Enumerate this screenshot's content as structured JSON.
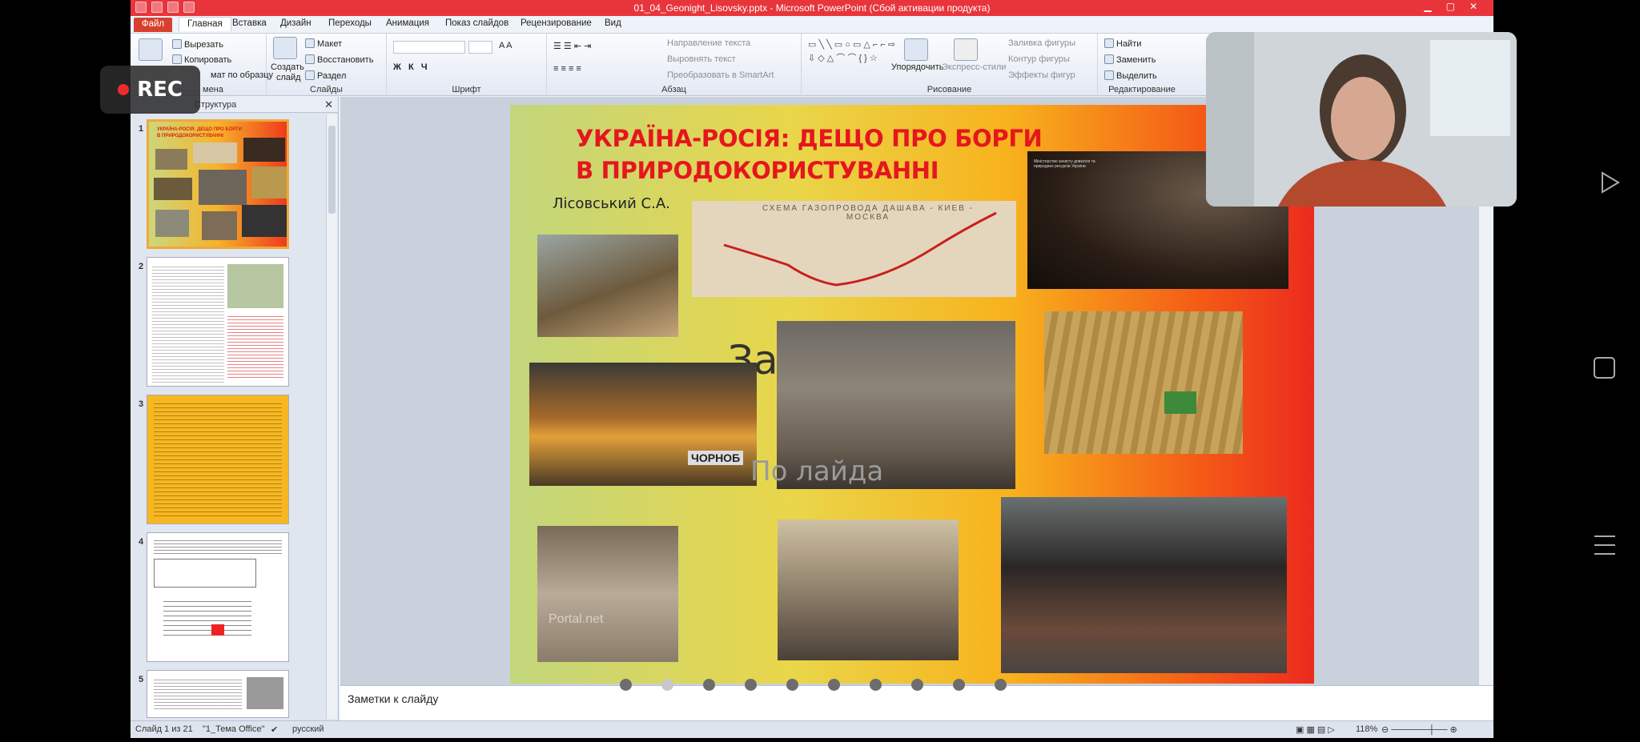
{
  "titlebar": {
    "title": "01_04_Geonight_Lisovsky.pptx - Microsoft PowerPoint (Сбой активации продукта)"
  },
  "tabs": [
    "Файл",
    "Главная",
    "Вставка",
    "Дизайн",
    "Переходы",
    "Анимация",
    "Показ слайдов",
    "Рецензирование",
    "Вид"
  ],
  "ribbon": {
    "clipboard": {
      "cut": "Вырезать",
      "copy": "Копировать",
      "format_painter": "мат по образцу",
      "label": "мена"
    },
    "slides": {
      "create": "Создать",
      "slide": "слайд",
      "layout": "Макет",
      "restore": "Восстановить",
      "section": "Раздел",
      "label": "Слайды"
    },
    "font": {
      "label": "Шрифт"
    },
    "paragraph": {
      "text_direction": "Направление текста",
      "align_text": "Выровнять текст",
      "smartart": "Преобразовать в SmartArt",
      "label": "Абзац"
    },
    "drawing": {
      "arrange": "Упорядочить",
      "quick_styles": "Экспресс-стили",
      "fill": "Заливка фигуры",
      "outline": "Контур фигуры",
      "effects": "Эффекты фигур",
      "label": "Рисование"
    },
    "editing": {
      "find": "Найти",
      "replace": "Заменить",
      "select": "Выделить",
      "label": "Редактирование"
    }
  },
  "rec_label": "REC",
  "panel": {
    "structure_tab": "Структура",
    "close": "✕"
  },
  "thumbnails": [
    {
      "num": "1",
      "title": "УКРАЇНА-РОСІЯ: ДЕЩО ПРО БОРГИ В ПРИРОДОКОРИСТУВАННІ"
    },
    {
      "num": "2"
    },
    {
      "num": "3"
    },
    {
      "num": "4"
    },
    {
      "num": "5"
    }
  ],
  "slide": {
    "title": "УКРАЇНА-РОСІЯ: ДЕЩО  ПРО БОРГИ В ПРИРОДОКОРИСТУВАННІ",
    "author": "Лісовський С.А.",
    "map_caption": "СХЕМА ГАЗОПРОВОДА ДАШАВА - КИЕВ - МОСКВА",
    "placeholder_title": "За           лай",
    "placeholder_subtitle": "По                  лайда",
    "watermark": "Portal.net",
    "ministry_text": "Міністерство захисту довкілля та природних ресурсів України",
    "sign_text": "ЧОРНОБ"
  },
  "notes": {
    "placeholder": "Заметки к слайду"
  },
  "status": {
    "slide_counter": "Слайд 1 из 21",
    "theme": "\"1_Тема Office\"",
    "language": "русский",
    "zoom": "118%"
  },
  "colors": {
    "title_red": "#e5161e",
    "titlebar": "#e8353b",
    "selected_thumb": "#f0a83a"
  }
}
